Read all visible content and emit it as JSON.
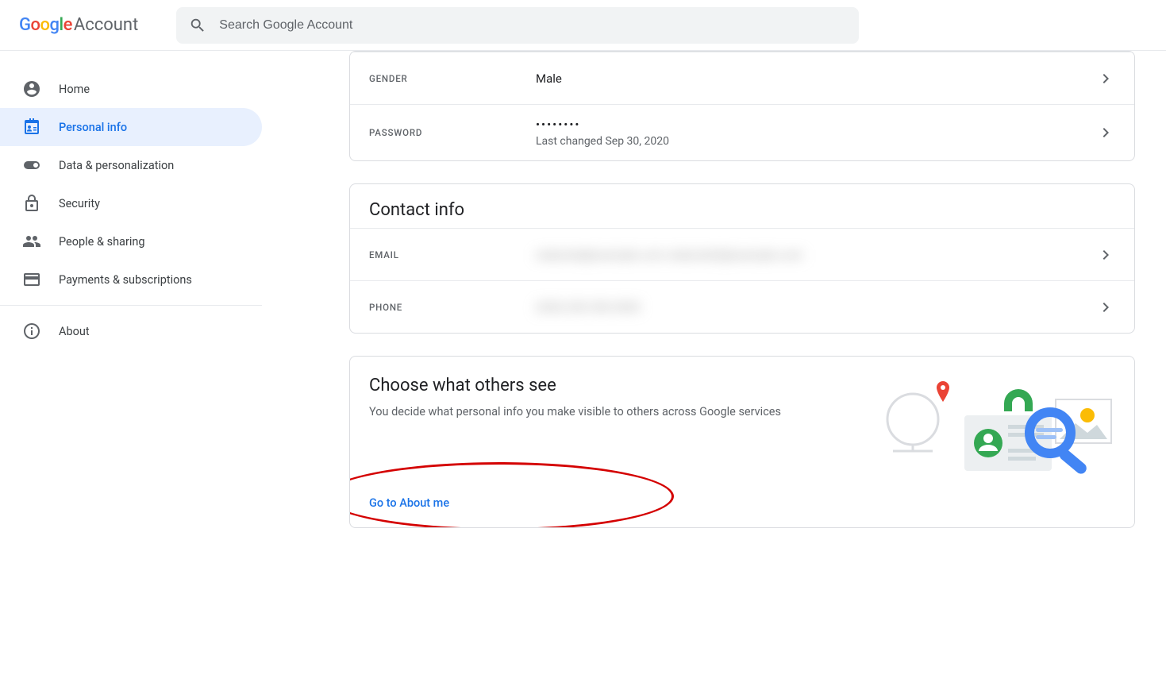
{
  "header": {
    "product": "Account",
    "search_placeholder": "Search Google Account"
  },
  "sidebar": {
    "items": [
      {
        "label": "Home"
      },
      {
        "label": "Personal info"
      },
      {
        "label": "Data & personalization"
      },
      {
        "label": "Security"
      },
      {
        "label": "People & sharing"
      },
      {
        "label": "Payments & subscriptions"
      },
      {
        "label": "About"
      }
    ]
  },
  "basic": {
    "gender_label": "GENDER",
    "gender_value": "Male",
    "password_label": "PASSWORD",
    "password_mask": "••••••••",
    "password_sub": "Last changed Sep 30, 2020"
  },
  "contact": {
    "title": "Contact info",
    "email_label": "EMAIL",
    "email_value": "redacted@example.com\nredacted2@example.com",
    "phone_label": "PHONE",
    "phone_value": "(555) 555\n555-5555"
  },
  "choose": {
    "title": "Choose what others see",
    "desc": "You decide what personal info you make visible to others across Google services",
    "link": "Go to About me"
  }
}
